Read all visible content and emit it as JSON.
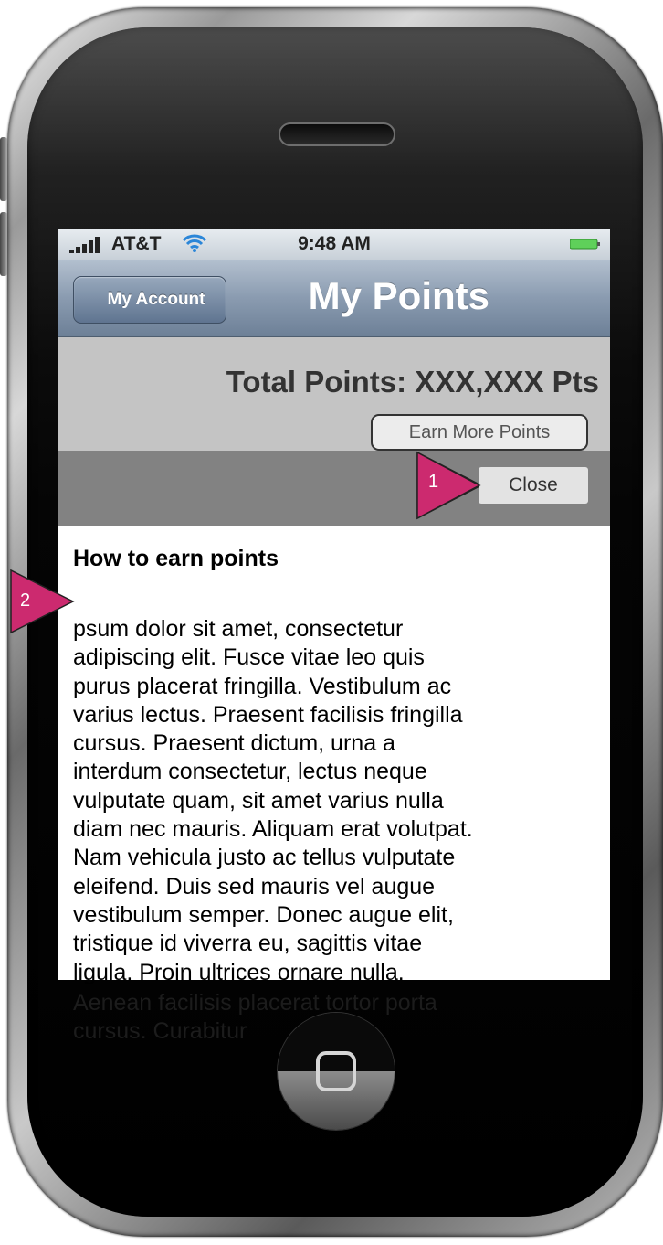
{
  "status_bar": {
    "carrier": "AT&T",
    "time": "9:48 AM"
  },
  "nav": {
    "back_label": "My Account",
    "title": "My Points"
  },
  "points": {
    "total_label": "Total Points: XXX,XXX Pts",
    "earn_button_label": "Earn More Points"
  },
  "modal": {
    "close_label": "Close",
    "heading": "How to earn points",
    "body_lines": [
      "psum dolor sit amet, consectetur",
      "adipiscing elit. Fusce vitae leo quis",
      "purus placerat fringilla. Vestibulum ac",
      "varius lectus. Praesent facilisis fringilla",
      "cursus. Praesent dictum, urna a",
      "interdum consectetur, lectus neque",
      "vulputate quam, sit amet varius nulla",
      "diam nec mauris. Aliquam erat volutpat.",
      "Nam vehicula justo ac tellus vulputate",
      "eleifend. Duis sed mauris vel augue",
      "vestibulum semper. Donec augue elit,",
      "tristique id viverra eu, sagittis vitae",
      "ligula. Proin ultrices ornare nulla."
    ],
    "overflow_lines": [
      "Aenean facilisis placerat tortor porta",
      "cursus. Curabitur"
    ]
  },
  "annotations": {
    "marker_1": "1",
    "marker_2": "2"
  },
  "colors": {
    "marker": "#cc2a6f",
    "nav_bar": "#7d8ea5",
    "modal_header": "#828282"
  }
}
